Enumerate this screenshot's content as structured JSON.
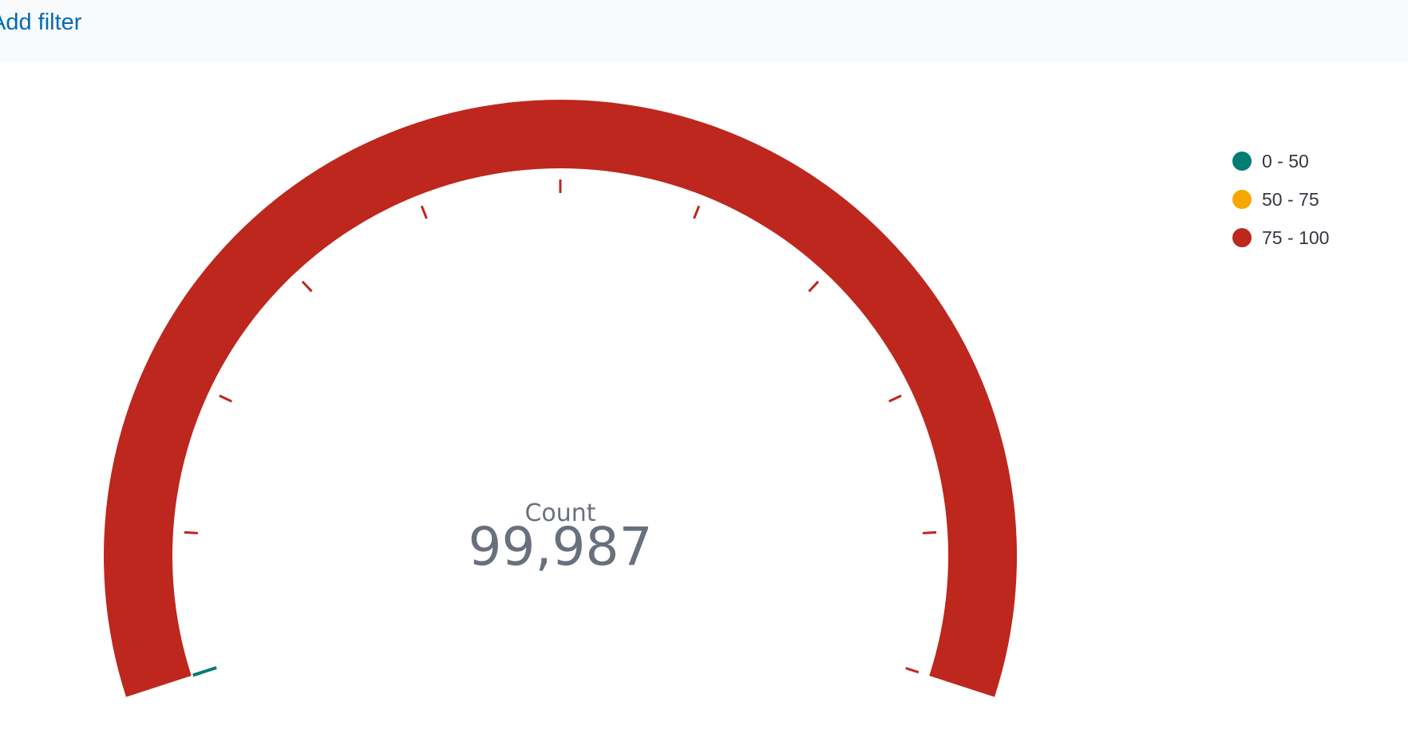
{
  "filter_bar": {
    "add_filter_label": "Add filter"
  },
  "gauge": {
    "label": "Count",
    "value_text": "99,987",
    "value": 99987,
    "range_min": 0,
    "range_max": 100,
    "current_range_color": "#bd271e",
    "ranges": [
      {
        "label": "0 - 50",
        "from": 0,
        "to": 50,
        "color": "#017d73"
      },
      {
        "label": "50 - 75",
        "from": 50,
        "to": 75,
        "color": "#f5a700"
      },
      {
        "label": "75 - 100",
        "from": 75,
        "to": 100,
        "color": "#bd271e"
      }
    ],
    "text_color": "#69707d"
  },
  "legend": {
    "items": [
      {
        "label": "0 - 50",
        "color": "#017d73"
      },
      {
        "label": "50 - 75",
        "color": "#f5a700"
      },
      {
        "label": "75 - 100",
        "color": "#bd271e"
      }
    ]
  }
}
